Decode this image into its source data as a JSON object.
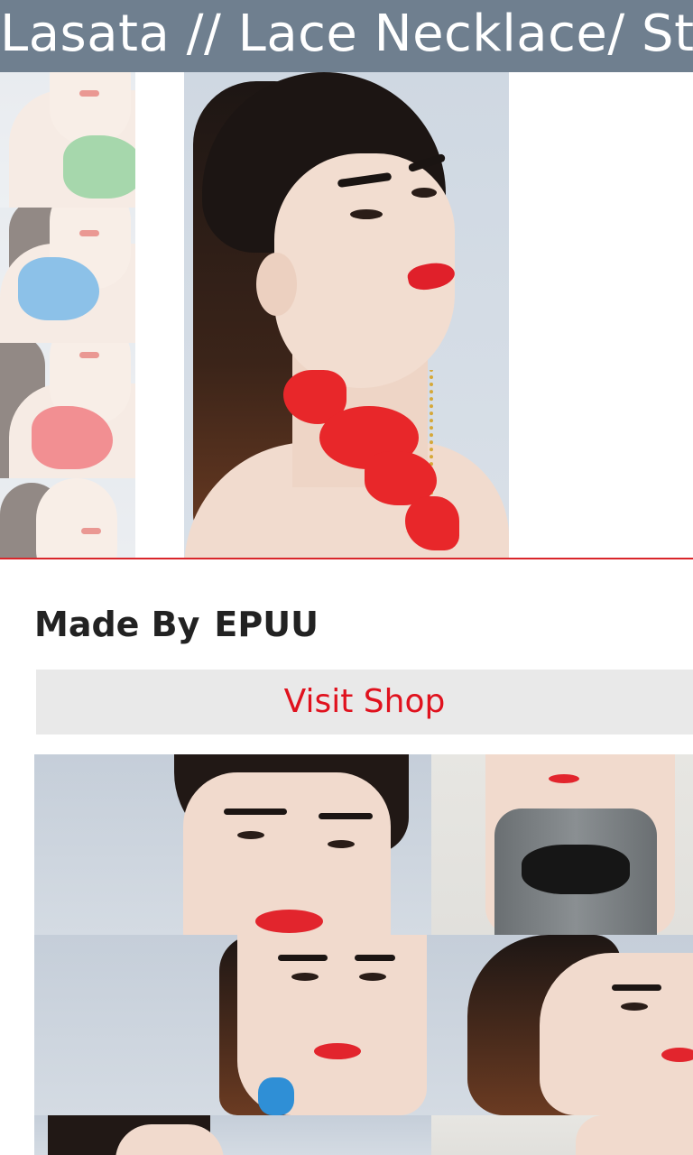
{
  "header": {
    "title": "Lasata // Lace Necklace/ Statement Necklace/ Red Necklace"
  },
  "gallery": {
    "thumbnails": [
      {
        "name": "green-lace-thumbnail",
        "lace_color": "#5fb86a"
      },
      {
        "name": "blue-lace-thumbnail",
        "lace_color": "#2f8fd6"
      },
      {
        "name": "red-lace-thumbnail",
        "lace_color": "#e8343a"
      },
      {
        "name": "model-thumbnail",
        "lace_color": "#e8343a"
      }
    ],
    "main_lace_color": "#e8272a"
  },
  "seller": {
    "made_by_label": "Made By",
    "shop_name": "EPUU",
    "visit_shop_label": "Visit Shop"
  },
  "colors": {
    "header_bg": "#6f7f8f",
    "accent": "#e0121e",
    "button_bg": "#e9e9e9"
  }
}
